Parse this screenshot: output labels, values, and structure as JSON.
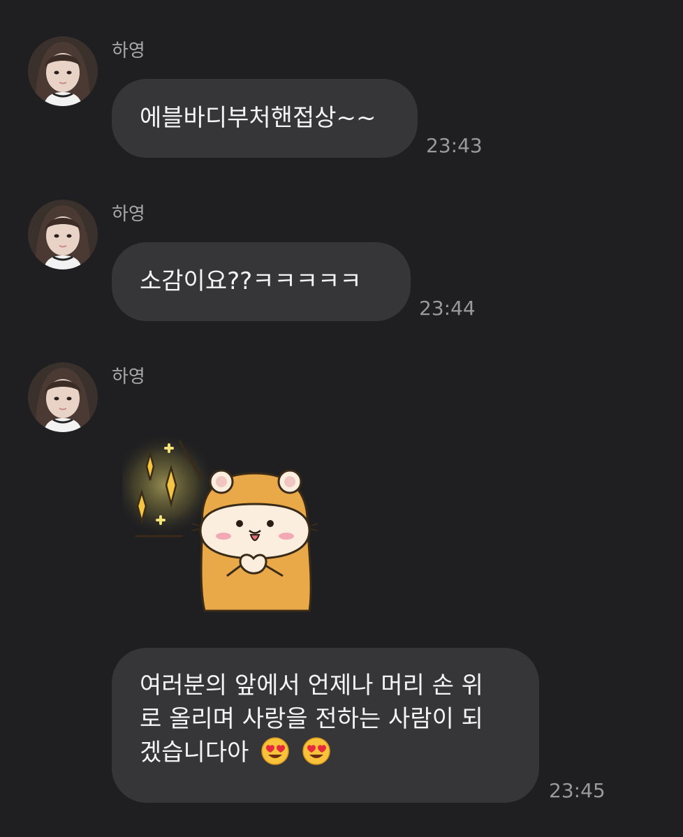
{
  "messages": [
    {
      "sender": "하영",
      "text": "에블바디부처핸접상~~",
      "time": "23:43"
    },
    {
      "sender": "하영",
      "text": "소감이요??ㅋㅋㅋㅋㅋ",
      "time": "23:44"
    },
    {
      "sender": "하영",
      "text": "여러분의 앞에서 언제나 머리 손 위\n로 올리며 사랑을 전하는 사람이 되\n겠습니다아",
      "time": "23:45"
    }
  ],
  "icons": {
    "avatar": "profile-photo",
    "sticker": "hamster-sparkle-sticker",
    "emoji": "heart-eyes-emoji"
  },
  "colors": {
    "background": "#1f1f21",
    "bubble": "#363638",
    "text": "#f4f4f4",
    "meta": "#9a9a9e"
  }
}
